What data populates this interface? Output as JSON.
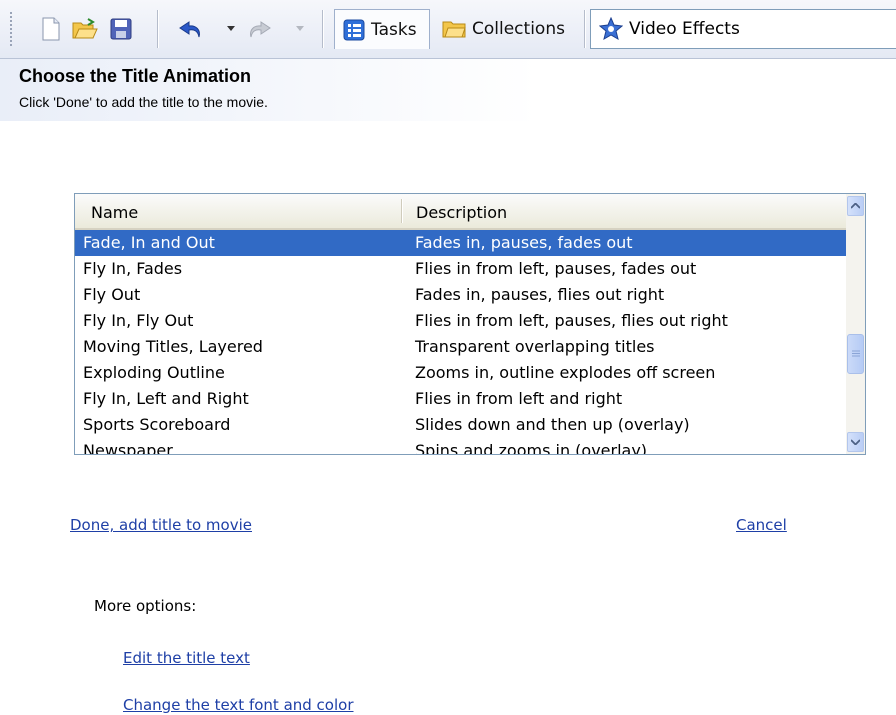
{
  "toolbar": {
    "tabs": [
      {
        "label": "Tasks"
      },
      {
        "label": "Collections"
      }
    ],
    "combo_value": "Video Effects"
  },
  "header": {
    "title": "Choose the Title Animation",
    "subtitle": "Click 'Done' to add the title to the movie."
  },
  "list": {
    "columns": [
      "Name",
      "Description"
    ],
    "rows": [
      {
        "name": "Fade, In and Out",
        "desc": "Fades in, pauses, fades out",
        "selected": true
      },
      {
        "name": "Fly In, Fades",
        "desc": "Flies in from left, pauses, fades out"
      },
      {
        "name": "Fly Out",
        "desc": "Fades in, pauses, flies out right"
      },
      {
        "name": "Fly In, Fly Out",
        "desc": "Flies in from left, pauses, flies out right"
      },
      {
        "name": "Moving Titles, Layered",
        "desc": "Transparent overlapping titles"
      },
      {
        "name": "Exploding Outline",
        "desc": "Zooms in, outline explodes off screen"
      },
      {
        "name": "Fly In, Left and Right",
        "desc": "Flies in from left and right"
      },
      {
        "name": "Sports Scoreboard",
        "desc": "Slides down and then up (overlay)"
      },
      {
        "name": "Newspaper",
        "desc": "Spins and zooms in (overlay)"
      }
    ]
  },
  "actions": {
    "done": "Done, add title to movie",
    "cancel": "Cancel"
  },
  "more": {
    "label": "More options:",
    "edit_text": "Edit the title text",
    "change_font": "Change the text font and color"
  },
  "colors": {
    "selection": "#316ac5",
    "link": "#1e3fa6"
  }
}
